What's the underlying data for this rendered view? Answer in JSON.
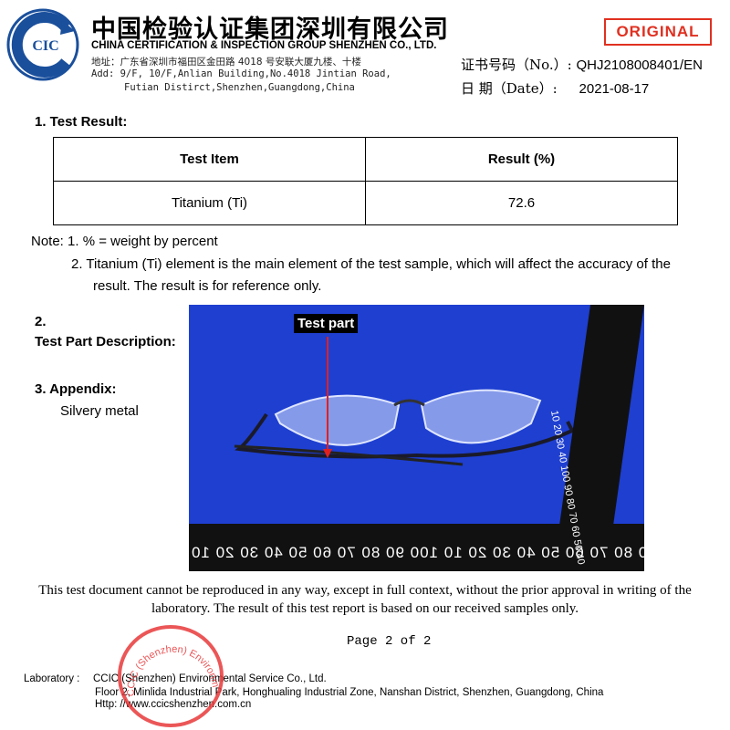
{
  "header": {
    "logo_text": "CIC",
    "company_cn": "中国检验认证集团深圳有限公司",
    "company_en": "CHINA CERTIFICATION & INSPECTION GROUP SHENZHEN CO., LTD.",
    "address_cn": "地址：广东省深圳市福田区金田路 4018 号安联大厦九楼、十楼",
    "address_en_1": "Add:  9/F, 10/F,Anlian Building,No.4018 Jintian Road,",
    "address_en_2": "Futian Distirct,Shenzhen,Guangdong,China",
    "badge": "ORIGINAL",
    "cert_label": "证书号码（No.）:",
    "cert_no": "QHJ2108008401/EN",
    "date_label": "日  期（Date）:",
    "date": "2021-08-17"
  },
  "section1": {
    "heading": "1.   Test Result:",
    "columns": [
      "Test Item",
      "Result (%)"
    ],
    "rows": [
      [
        "Titanium (Ti)",
        "72.6"
      ]
    ]
  },
  "notes": {
    "n1": "Note:  1. % = weight by percent",
    "n2a": "2. Titanium (Ti) element is the main element of the test sample, which will affect the accuracy of the",
    "n2b": "result. The result is for reference only."
  },
  "section2": {
    "num": "2.",
    "heading": "Test Part Description:"
  },
  "section3": {
    "heading": "3.   Appendix:",
    "value": "Silvery metal"
  },
  "photo": {
    "label": "Test part",
    "ruler_bottom": "0 80 70 60 50 40 30 20 10 100 90 80 70 60 50 40 30 20 10",
    "ruler_side": "10 20 30 40 100 90 80 70 60 50 40"
  },
  "disclaimer": {
    "l1": "This test document cannot be reproduced in any way, except in full context, without the prior approval in writing of the",
    "l2": "laboratory.    The result of this test report is based on our received samples only."
  },
  "page": "Page 2 of 2",
  "stamp_text": "CCIC (Shenzhen) Environmental Service Co.",
  "laboratory": {
    "label": "Laboratory :",
    "name": "CCIC (Shenzhen) Environmental Service Co., Ltd.",
    "address": "Floor 2, Minlida Industrial Park, Honghualing Industrial Zone, Nanshan District, Shenzhen, Guangdong, China",
    "web": "Http: //www.ccicshenzhen.com.cn"
  },
  "colors": {
    "brand": "#1a4f9c",
    "badge": "#e03020",
    "photo_bg": "#1e3fd0",
    "stamp": "#e8383a"
  }
}
